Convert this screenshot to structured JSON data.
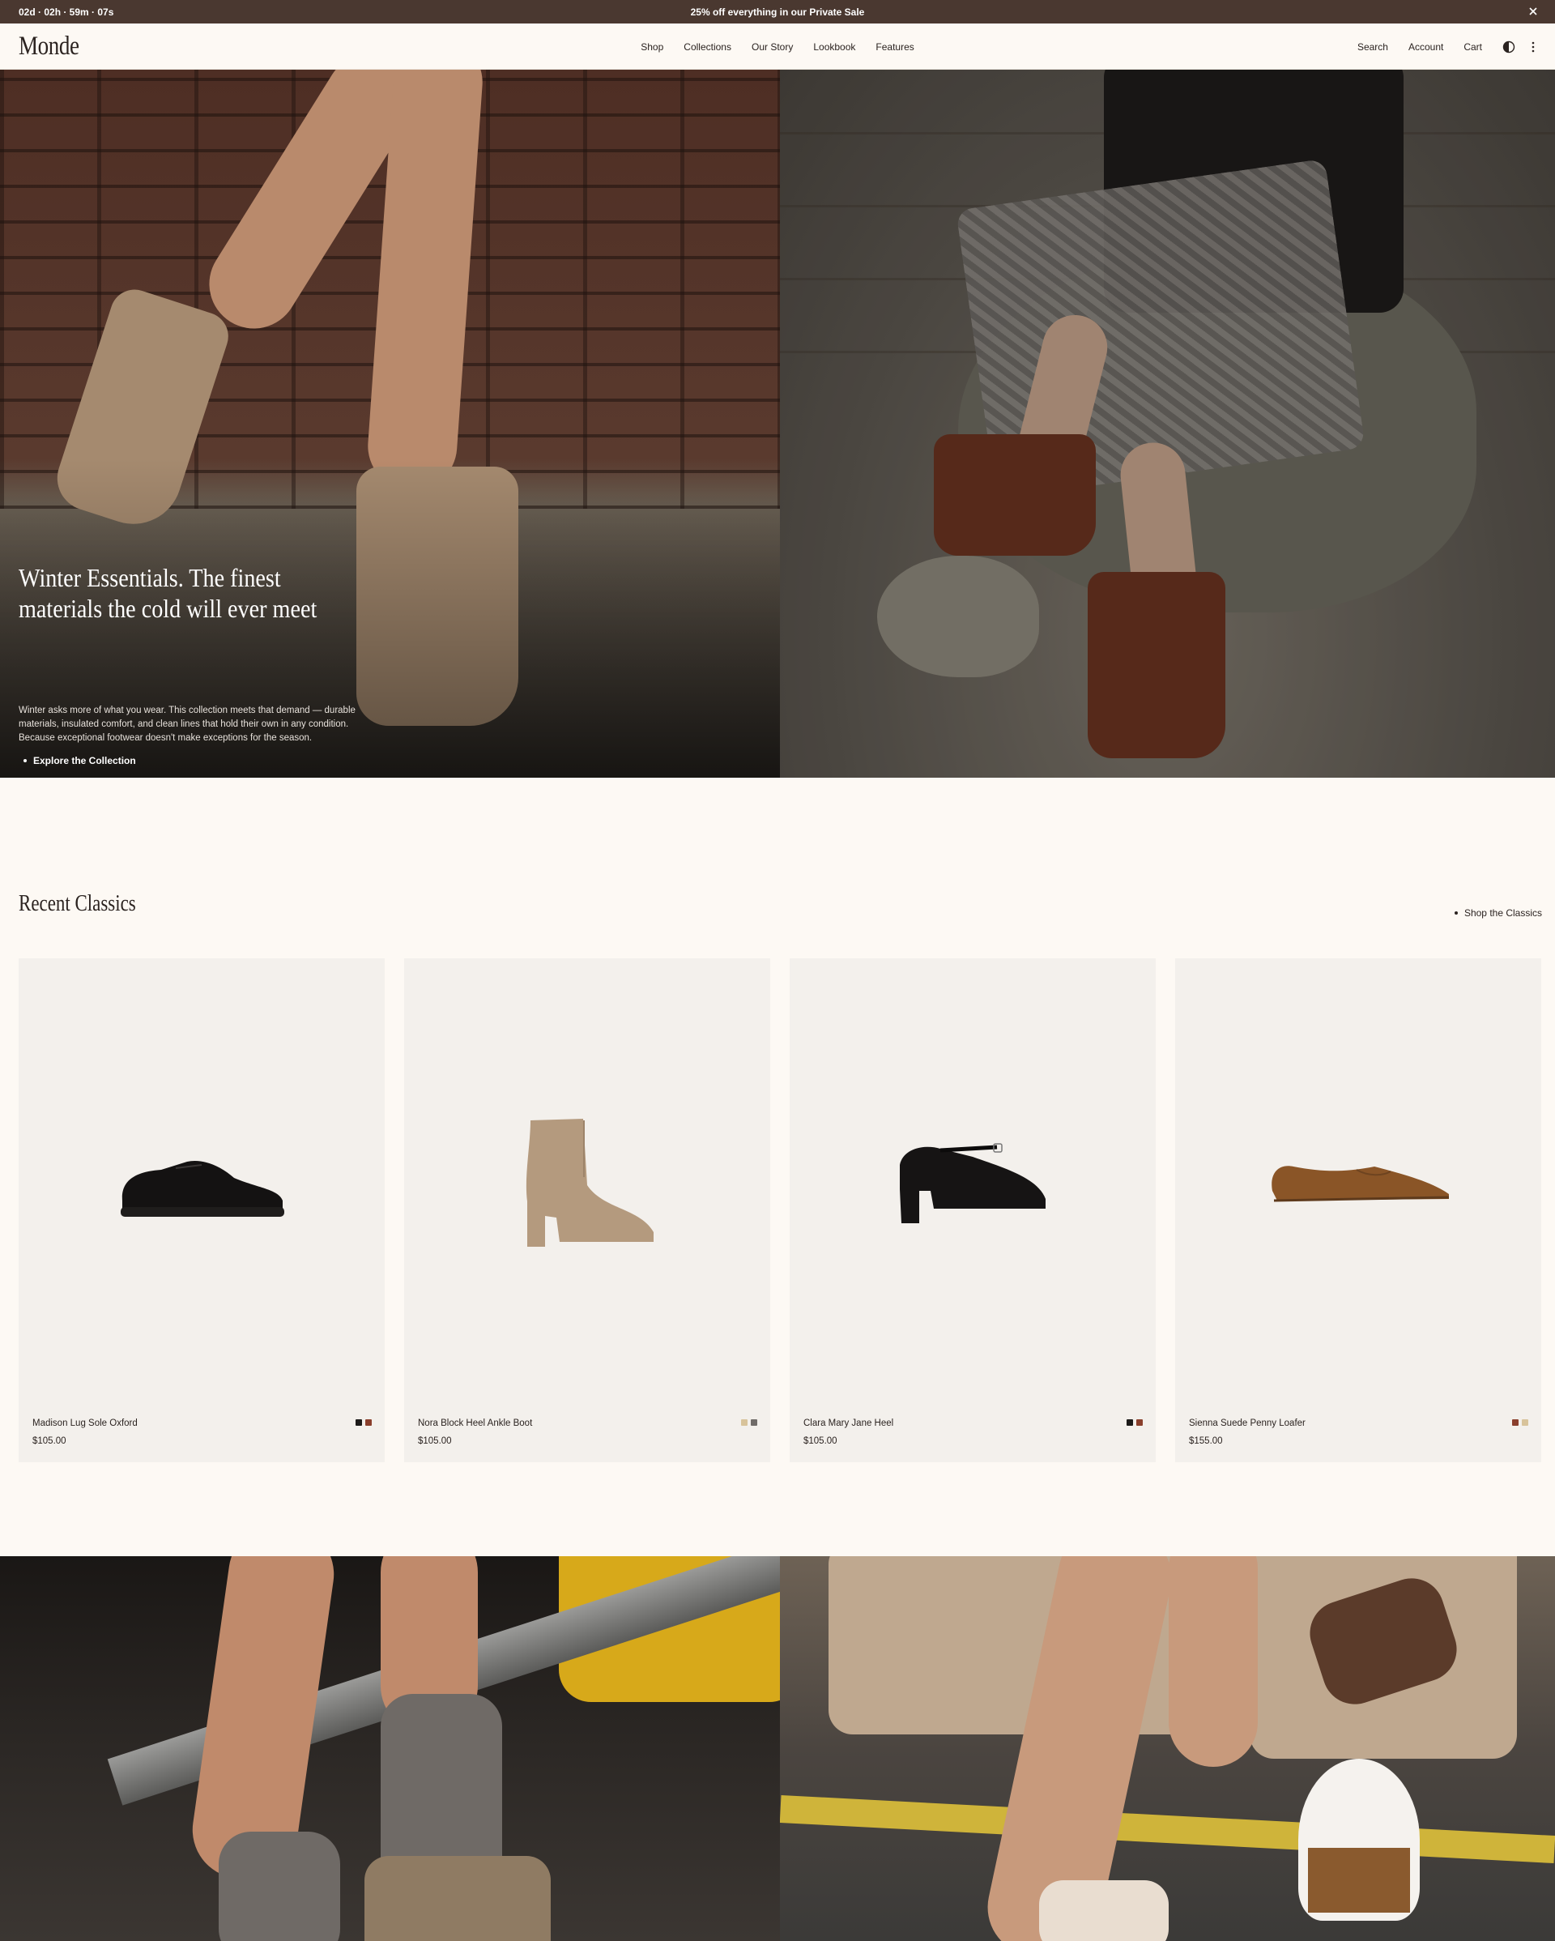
{
  "announcement": {
    "countdown": "02d · 02h · 59m · 07s",
    "promo": "25% off everything in our Private Sale"
  },
  "header": {
    "logo": "Monde",
    "nav": [
      "Shop",
      "Collections",
      "Our Story",
      "Lookbook",
      "Features"
    ],
    "utilities": [
      "Search",
      "Account",
      "Cart"
    ]
  },
  "hero": {
    "title": "Winter Essentials. The finest materials the cold will ever meet",
    "body": "Winter asks more of what you wear. This collection meets that demand — durable materials, insulated comfort, and clean lines that hold their own in any condition. Because exceptional footwear doesn't make exceptions for the season.",
    "cta": "Explore the Collection"
  },
  "classics": {
    "title": "Recent Classics",
    "link": "Shop the Classics",
    "products": [
      {
        "name": "Madison Lug Sole Oxford",
        "price": "$105.00",
        "swatches": [
          "#1c1a19",
          "#8a3f2c"
        ],
        "icon": "oxford-shoe-icon"
      },
      {
        "name": "Nora Block Heel Ankle Boot",
        "price": "$105.00",
        "swatches": [
          "#d8c39a",
          "#6f6b68"
        ],
        "icon": "ankle-boot-icon"
      },
      {
        "name": "Clara Mary Jane Heel",
        "price": "$105.00",
        "swatches": [
          "#1c1a19",
          "#8a3f2c"
        ],
        "icon": "mary-jane-heel-icon"
      },
      {
        "name": "Sienna Suede Penny Loafer",
        "price": "$155.00",
        "swatches": [
          "#8a3f2c",
          "#d8c39a"
        ],
        "icon": "loafer-icon"
      }
    ]
  },
  "colors": {
    "announcement_bg": "#4a3830",
    "page_bg": "#fdf9f4",
    "card_bg": "#f3f0ec",
    "text": "#2b2320"
  }
}
